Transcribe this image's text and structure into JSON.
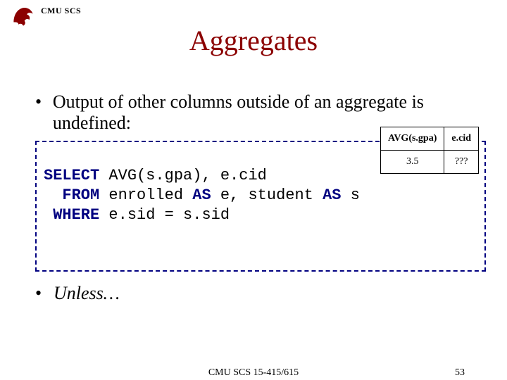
{
  "header": {
    "org": "CMU SCS"
  },
  "title": "Aggregates",
  "bullets": {
    "b1": "Output of other columns outside of an aggregate is undefined:",
    "b2": "Unless…"
  },
  "sql": {
    "kw_select": "SELECT",
    "select_cols": " AVG(s.gpa), e.cid",
    "kw_from": "  FROM",
    "from_body": " enrolled ",
    "kw_as1": "AS",
    "from_body2": " e, student ",
    "kw_as2": "AS",
    "from_body3": " s",
    "kw_where": " WHERE",
    "where_body": " e.sid = s.sid"
  },
  "result_table": {
    "h1": "AVG(s.gpa)",
    "h2": "e.cid",
    "v1": "3.5",
    "v2": "???"
  },
  "footer": {
    "center": "CMU SCS 15-415/615",
    "page": "53"
  }
}
